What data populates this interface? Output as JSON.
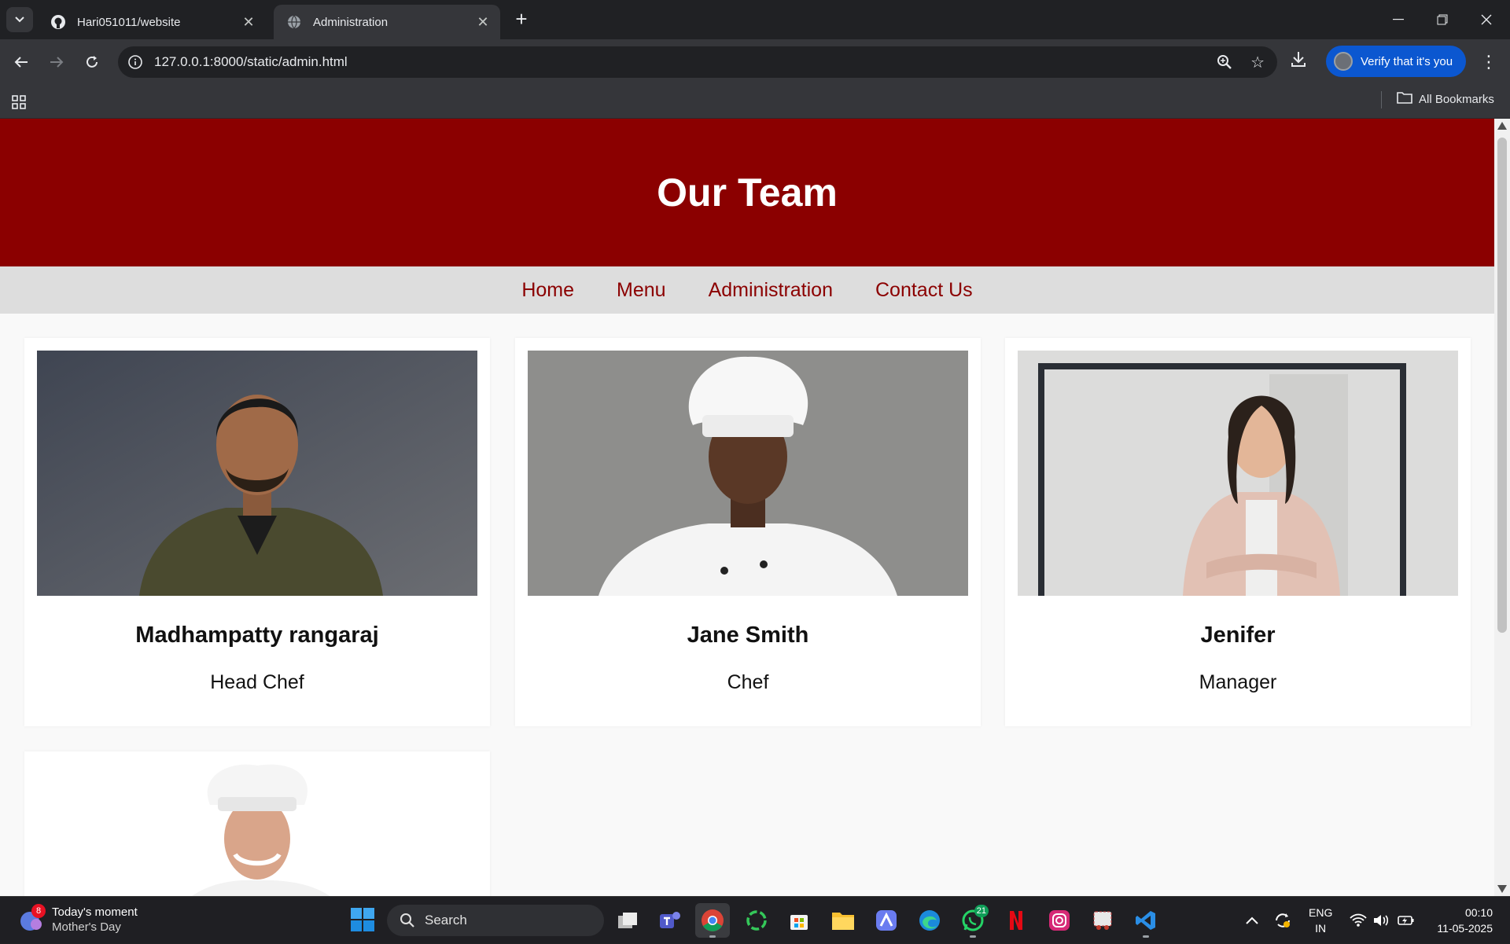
{
  "browser": {
    "tabs": [
      {
        "title": "Hari051011/website",
        "active": false
      },
      {
        "title": "Administration",
        "active": true
      }
    ],
    "url": "127.0.0.1:8000/static/admin.html",
    "verify_label": "Verify that it's you",
    "bookmarks_label": "All Bookmarks"
  },
  "page": {
    "title": "Our Team",
    "nav": [
      "Home",
      "Menu",
      "Administration",
      "Contact Us"
    ],
    "team": [
      {
        "name": "Madhampatty rangaraj",
        "role": "Head Chef"
      },
      {
        "name": "Jane Smith",
        "role": "Chef"
      },
      {
        "name": "Jenifer",
        "role": "Manager"
      },
      {
        "name": "",
        "role": ""
      }
    ],
    "colors": {
      "header_bg": "#8b0000",
      "nav_bg": "#dddddd",
      "nav_link": "#8b0000",
      "page_bg": "#f9f9f9"
    }
  },
  "taskbar": {
    "widget_title": "Today's moment",
    "widget_sub": "Mother's Day",
    "widget_badge": "8",
    "search_placeholder": "Search",
    "whatsapp_count": "21",
    "lang_line1": "ENG",
    "lang_line2": "IN",
    "time": "00:10",
    "date": "11-05-2025"
  }
}
